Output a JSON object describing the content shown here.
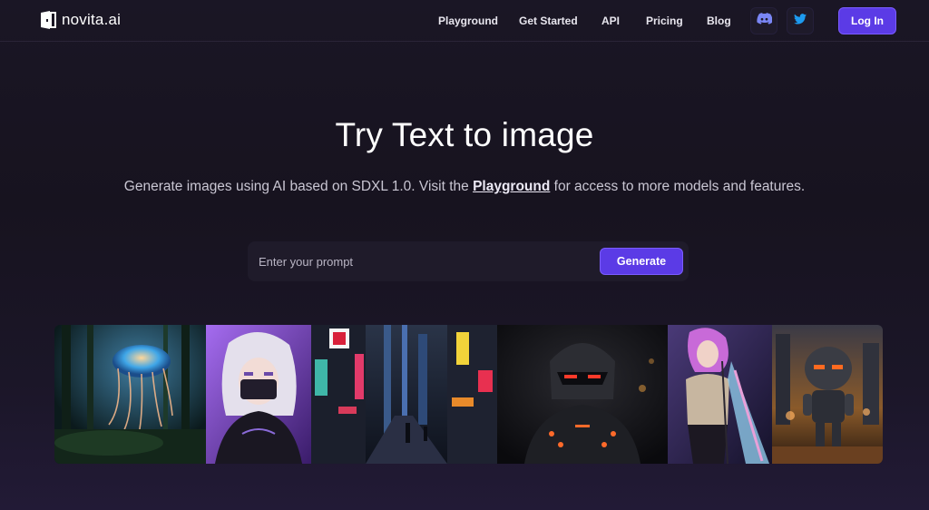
{
  "brand": {
    "name": "novita.ai"
  },
  "nav": {
    "links": [
      "Playground",
      "Get Started",
      "API",
      "Pricing",
      "Blog"
    ],
    "discord_icon": "discord-icon",
    "twitter_icon": "twitter-icon",
    "login_label": "Log In"
  },
  "hero": {
    "title": "Try Text to image",
    "subtitle_before": "Generate images using AI based on SDXL 1.0. Visit the ",
    "subtitle_link": "Playground",
    "subtitle_after": " for access to more models and features."
  },
  "prompt": {
    "placeholder": "Enter your prompt",
    "value": "",
    "generate_label": "Generate"
  },
  "gallery": {
    "images": [
      "jellyfish-forest",
      "anime-girl-masked",
      "neon-city-street",
      "robot-helmet",
      "purple-hair-singer",
      "chibi-robot"
    ]
  },
  "colors": {
    "accent": "#5b3be6",
    "background": "#17131f",
    "twitter": "#1d9bf0",
    "discord": "#7a86f5"
  }
}
